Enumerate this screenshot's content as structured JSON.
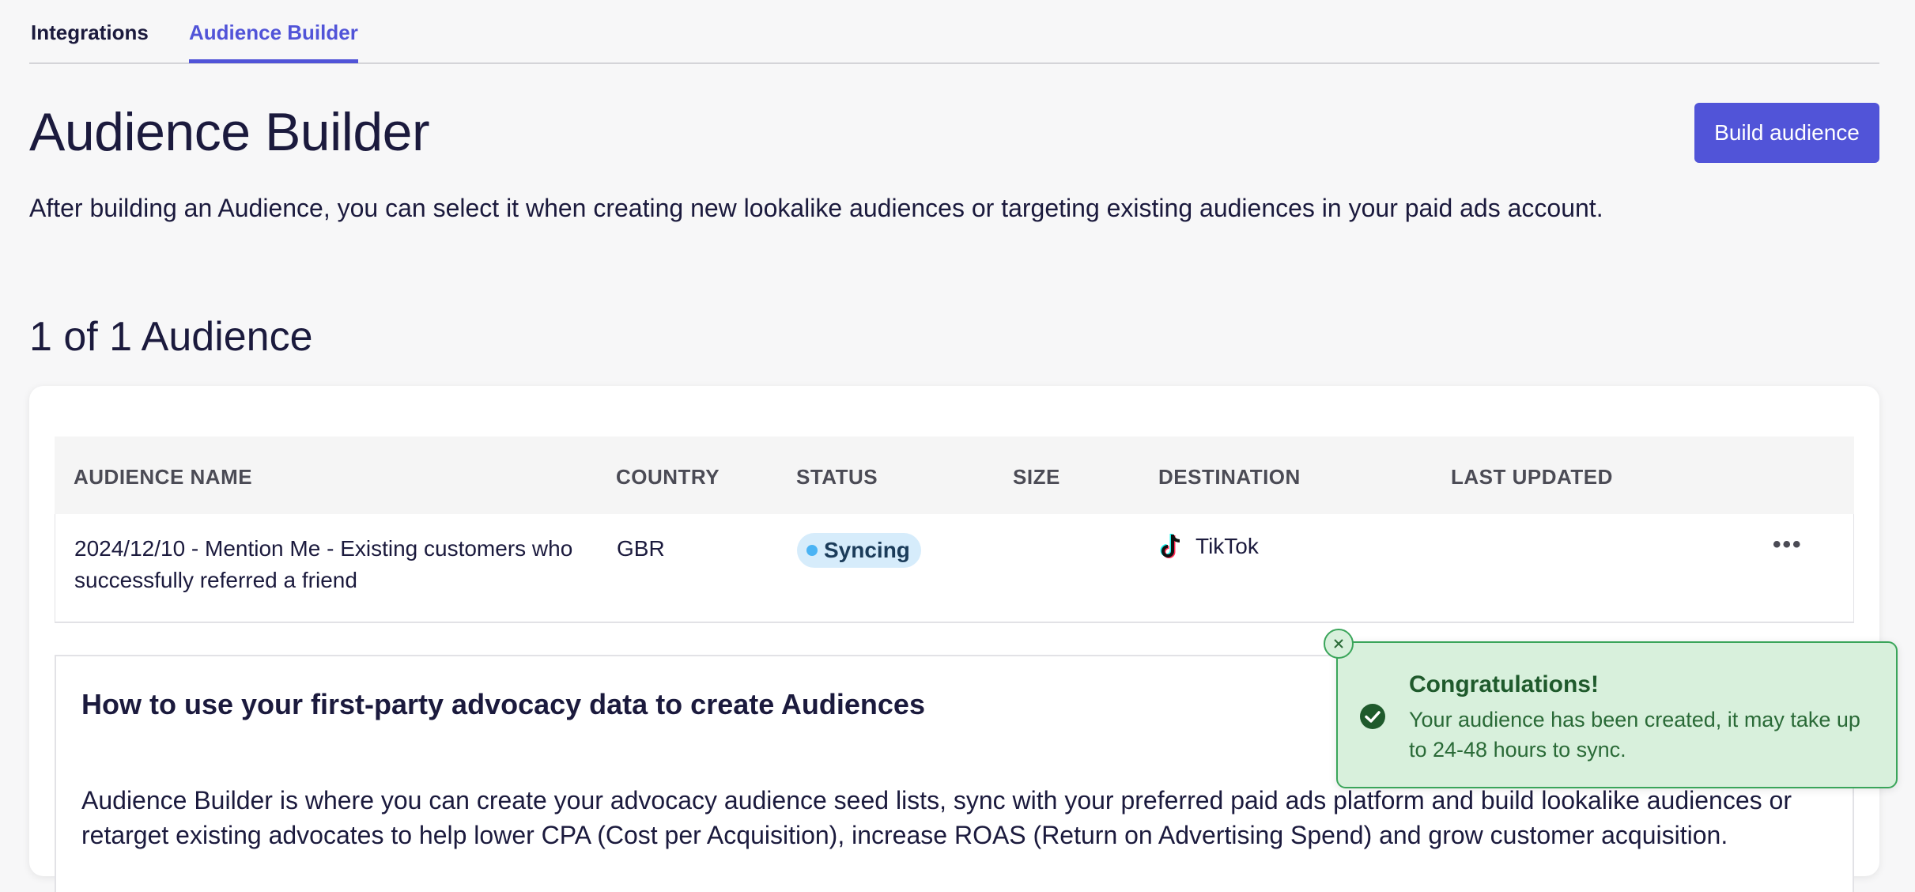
{
  "tabs": [
    {
      "label": "Integrations"
    },
    {
      "label": "Audience Builder"
    }
  ],
  "header": {
    "title": "Audience Builder",
    "build_button": "Build audience",
    "subtitle": "After building an Audience, you can select it when creating new lookalike audiences or targeting existing audiences in your paid ads account."
  },
  "list": {
    "count_heading": "1 of 1 Audience",
    "columns": [
      "AUDIENCE NAME",
      "COUNTRY",
      "STATUS",
      "SIZE",
      "DESTINATION",
      "LAST UPDATED"
    ],
    "rows": [
      {
        "name": "2024/12/10 - Mention Me - Existing customers who successfully referred a friend",
        "country": "GBR",
        "status": "Syncing",
        "size": "",
        "destination": "TikTok",
        "destination_icon": "tiktok-icon",
        "last_updated": ""
      }
    ]
  },
  "info": {
    "heading": "How to use your first-party advocacy data to create Audiences",
    "body": "Audience Builder is where you can create your advocacy audience seed lists, sync with your preferred paid ads platform and build lookalike audiences or retarget existing advocates to help lower CPA (Cost per Acquisition), increase ROAS (Return on Advertising Spend) and grow customer acquisition."
  },
  "toast": {
    "title": "Congratulations!",
    "message": "Your audience has been created, it may take up to 24-48 hours to sync."
  },
  "colors": {
    "accent": "#5154d8",
    "syncing_badge": "#d6ecfb",
    "toast_bg": "#d8f0dc",
    "toast_border": "#3aa55a"
  }
}
